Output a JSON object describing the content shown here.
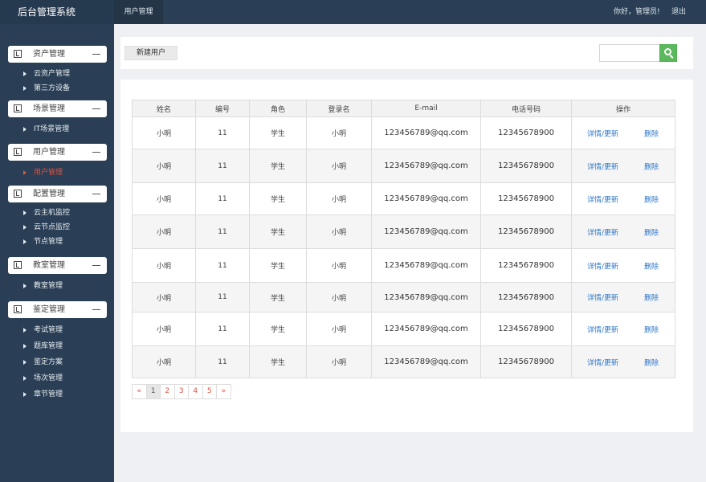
{
  "app": {
    "title": "后台管理系统"
  },
  "topbar": {
    "active_tab": "用户管理",
    "greeting": "你好，管理员!",
    "logout": "退出"
  },
  "sidebar": {
    "groups": [
      {
        "label": "资产管理",
        "items": [
          "云资产管理",
          "第三方设备"
        ]
      },
      {
        "label": "场景管理",
        "items": [
          "IT场景管理"
        ]
      },
      {
        "label": "用户管理",
        "items": [
          "用户管理"
        ]
      },
      {
        "label": "配置管理",
        "items": [
          "云主机监控",
          "云节点监控",
          "节点管理"
        ]
      },
      {
        "label": "教室管理",
        "items": [
          "教室管理"
        ]
      },
      {
        "label": "鉴定管理",
        "items": [
          "考试管理",
          "题库管理",
          "鉴定方案",
          "场次管理",
          "章节管理"
        ]
      }
    ],
    "active_item": "用户管理"
  },
  "toolbar": {
    "new_user_label": "新建用户",
    "search_placeholder": ""
  },
  "table": {
    "headers": [
      "姓名",
      "编号",
      "角色",
      "登录名",
      "E-mail",
      "电话号码",
      "操作"
    ],
    "rows": [
      [
        "小明",
        "11",
        "学生",
        "小明",
        "123456789@qq.com",
        "12345678900"
      ],
      [
        "小明",
        "11",
        "学生",
        "小明",
        "123456789@qq.com",
        "12345678900"
      ],
      [
        "小明",
        "11",
        "学生",
        "小明",
        "123456789@qq.com",
        "12345678900"
      ],
      [
        "小明",
        "11",
        "学生",
        "小明",
        "123456789@qq.com",
        "12345678900"
      ],
      [
        "小明",
        "11",
        "学生",
        "小明",
        "123456789@qq.com",
        "12345678900"
      ],
      [
        "小明",
        "11",
        "学生",
        "小明",
        "123456789@qq.com",
        "12345678900"
      ],
      [
        "小明",
        "11",
        "学生",
        "小明",
        "123456789@qq.com",
        "12345678900"
      ],
      [
        "小明",
        "11",
        "学生",
        "小明",
        "123456789@qq.com",
        "12345678900"
      ]
    ],
    "action_edit": "详情/更新",
    "action_delete": "删除"
  },
  "pagination": {
    "prev": "«",
    "pages": [
      "1",
      "2",
      "3",
      "4",
      "5"
    ],
    "next": "»",
    "current": "1"
  }
}
